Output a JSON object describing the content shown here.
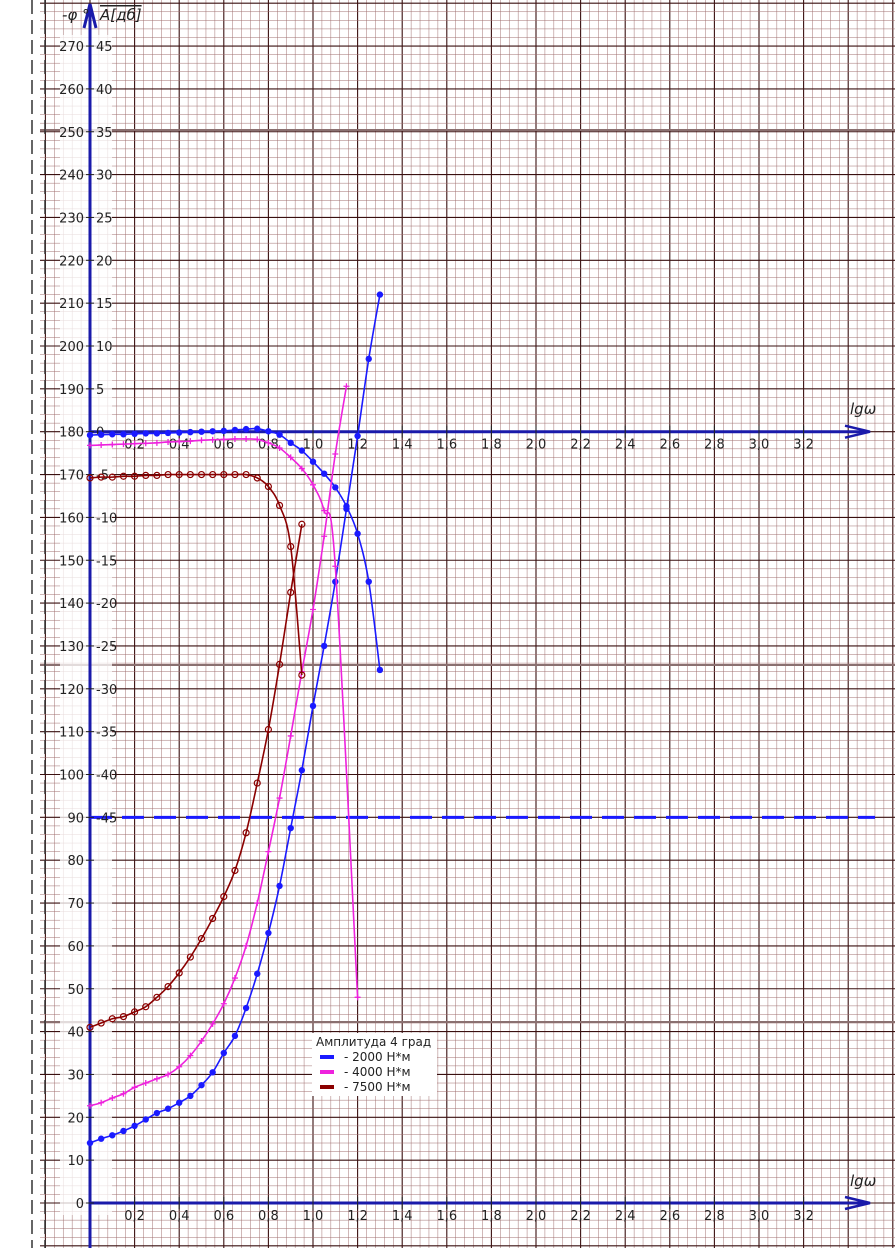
{
  "chart_data": {
    "type": "line",
    "title": "",
    "xlabel": "lgω",
    "ylabel_phase": "-φ °",
    "ylabel_amp": "A[дб]",
    "xlim": [
      0,
      3.4
    ],
    "phase_lim": [
      0,
      270
    ],
    "amp_lim": [
      -45,
      45
    ],
    "x_ticks": [
      "0,2",
      "0,4",
      "0,6",
      "0,8",
      "1,0",
      "1,2",
      "1,4",
      "1,6",
      "1,8",
      "2,0",
      "2,2",
      "2,4",
      "2,6",
      "2,8",
      "3,0",
      "3,2"
    ],
    "phase_ticks": [
      "0",
      "10",
      "20",
      "30",
      "40",
      "50",
      "60",
      "70",
      "80",
      "90",
      "100",
      "110",
      "120",
      "130",
      "140",
      "150",
      "160",
      "170",
      "180",
      "190",
      "200",
      "210",
      "220",
      "230",
      "240",
      "250",
      "260",
      "270"
    ],
    "amp_ticks": [
      "-45",
      "-40",
      "-35",
      "-30",
      "-25",
      "-20",
      "-15",
      "-10",
      "-5",
      "0",
      "5",
      "10",
      "15",
      "20",
      "25",
      "30",
      "35",
      "40",
      "45"
    ],
    "reference_line_phase": 90,
    "grid": true,
    "legend": {
      "title": "Амплитуда 4 град",
      "placement": "bottom-center",
      "entries": [
        "- 2000 Н*м",
        "- 4000 Н*м",
        "- 7500 Н*м"
      ]
    },
    "series": [
      {
        "name": "2000 Н*м phase",
        "kind": "phase",
        "color": "#1a1aff",
        "marker": "dot",
        "x": [
          0,
          0.05,
          0.1,
          0.15,
          0.2,
          0.25,
          0.3,
          0.35,
          0.4,
          0.45,
          0.5,
          0.55,
          0.6,
          0.65,
          0.7,
          0.75,
          0.8,
          0.85,
          0.9,
          0.95,
          1.0,
          1.05,
          1.1,
          1.15,
          1.2,
          1.25,
          1.3
        ],
        "values": [
          14,
          15,
          15.8,
          16.8,
          18,
          19.5,
          21,
          22,
          23.4,
          25,
          27.5,
          30.5,
          35,
          39,
          45.5,
          53.5,
          63,
          74,
          87.5,
          101,
          116,
          130,
          145,
          162,
          179,
          197,
          212
        ]
      },
      {
        "name": "2000 Н*м amplitude",
        "kind": "amp",
        "color": "#1a1aff",
        "marker": "dot",
        "x": [
          0,
          0.05,
          0.1,
          0.15,
          0.2,
          0.25,
          0.3,
          0.35,
          0.4,
          0.45,
          0.5,
          0.55,
          0.6,
          0.65,
          0.7,
          0.75,
          0.8,
          0.85,
          0.9,
          0.95,
          1.0,
          1.05,
          1.1,
          1.15,
          1.2,
          1.25,
          1.3
        ],
        "values": [
          -0.4,
          -0.35,
          -0.3,
          -0.3,
          -0.25,
          -0.2,
          -0.2,
          -0.15,
          -0.1,
          -0.05,
          0,
          0.05,
          0.1,
          0.2,
          0.3,
          0.35,
          0.05,
          -0.35,
          -1.3,
          -2.2,
          -3.5,
          -4.9,
          -6.5,
          -8.7,
          -11.9,
          -17.5,
          -27.8
        ]
      },
      {
        "name": "4000 Н*м phase",
        "kind": "phase",
        "color": "#ee22dd",
        "marker": "cross",
        "x": [
          0,
          0.05,
          0.1,
          0.15,
          0.2,
          0.25,
          0.3,
          0.35,
          0.4,
          0.45,
          0.5,
          0.55,
          0.6,
          0.65,
          0.7,
          0.75,
          0.8,
          0.85,
          0.9,
          0.95,
          1.0,
          1.05,
          1.1,
          1.15
        ],
        "values": [
          22.7,
          23.4,
          24.5,
          25.5,
          27,
          28,
          29,
          30,
          31.8,
          34.4,
          37.8,
          41.8,
          46.5,
          52.5,
          60,
          70,
          82,
          94.5,
          109,
          124,
          138.5,
          155.6,
          174.8,
          190.6
        ]
      },
      {
        "name": "4000 Н*м amplitude",
        "kind": "amp",
        "color": "#ee22dd",
        "marker": "cross",
        "x": [
          0,
          0.05,
          0.1,
          0.15,
          0.2,
          0.25,
          0.3,
          0.35,
          0.4,
          0.45,
          0.5,
          0.55,
          0.6,
          0.65,
          0.7,
          0.75,
          0.8,
          0.85,
          0.9,
          0.95,
          1.0,
          1.05,
          1.1,
          1.2
        ],
        "values": [
          -1.6,
          -1.55,
          -1.5,
          -1.45,
          -1.4,
          -1.35,
          -1.3,
          -1.2,
          -1.15,
          -1.1,
          -1.0,
          -0.95,
          -0.9,
          -0.85,
          -0.85,
          -0.9,
          -1.3,
          -1.9,
          -3.0,
          -4.3,
          -6.2,
          -9.2,
          -15.7,
          -66
        ]
      },
      {
        "name": "7500 Н*м phase",
        "kind": "phase",
        "color": "#8b0000",
        "marker": "ring",
        "x": [
          0,
          0.05,
          0.1,
          0.15,
          0.2,
          0.25,
          0.3,
          0.35,
          0.4,
          0.45,
          0.5,
          0.55,
          0.6,
          0.65,
          0.7,
          0.75,
          0.8,
          0.85,
          0.9,
          0.95
        ],
        "values": [
          41,
          42,
          43,
          43.5,
          44.6,
          45.8,
          48,
          50.5,
          53.7,
          57.4,
          61.7,
          66.4,
          71.5,
          77.6,
          86.4,
          98,
          110.5,
          125.7,
          142.5,
          158.4
        ]
      },
      {
        "name": "7500 Н*м amplitude",
        "kind": "amp",
        "color": "#8b0000",
        "marker": "ring",
        "x": [
          0,
          0.05,
          0.1,
          0.15,
          0.2,
          0.25,
          0.3,
          0.35,
          0.4,
          0.45,
          0.5,
          0.55,
          0.6,
          0.65,
          0.7,
          0.75,
          0.8,
          0.85,
          0.9,
          0.95
        ],
        "values": [
          -5.4,
          -5.3,
          -5.3,
          -5.2,
          -5.2,
          -5.1,
          -5.1,
          -5.0,
          -5.0,
          -5.0,
          -5.0,
          -5.0,
          -5.0,
          -5.0,
          -5.0,
          -5.4,
          -6.4,
          -8.6,
          -13.4,
          -28.4
        ]
      }
    ]
  }
}
